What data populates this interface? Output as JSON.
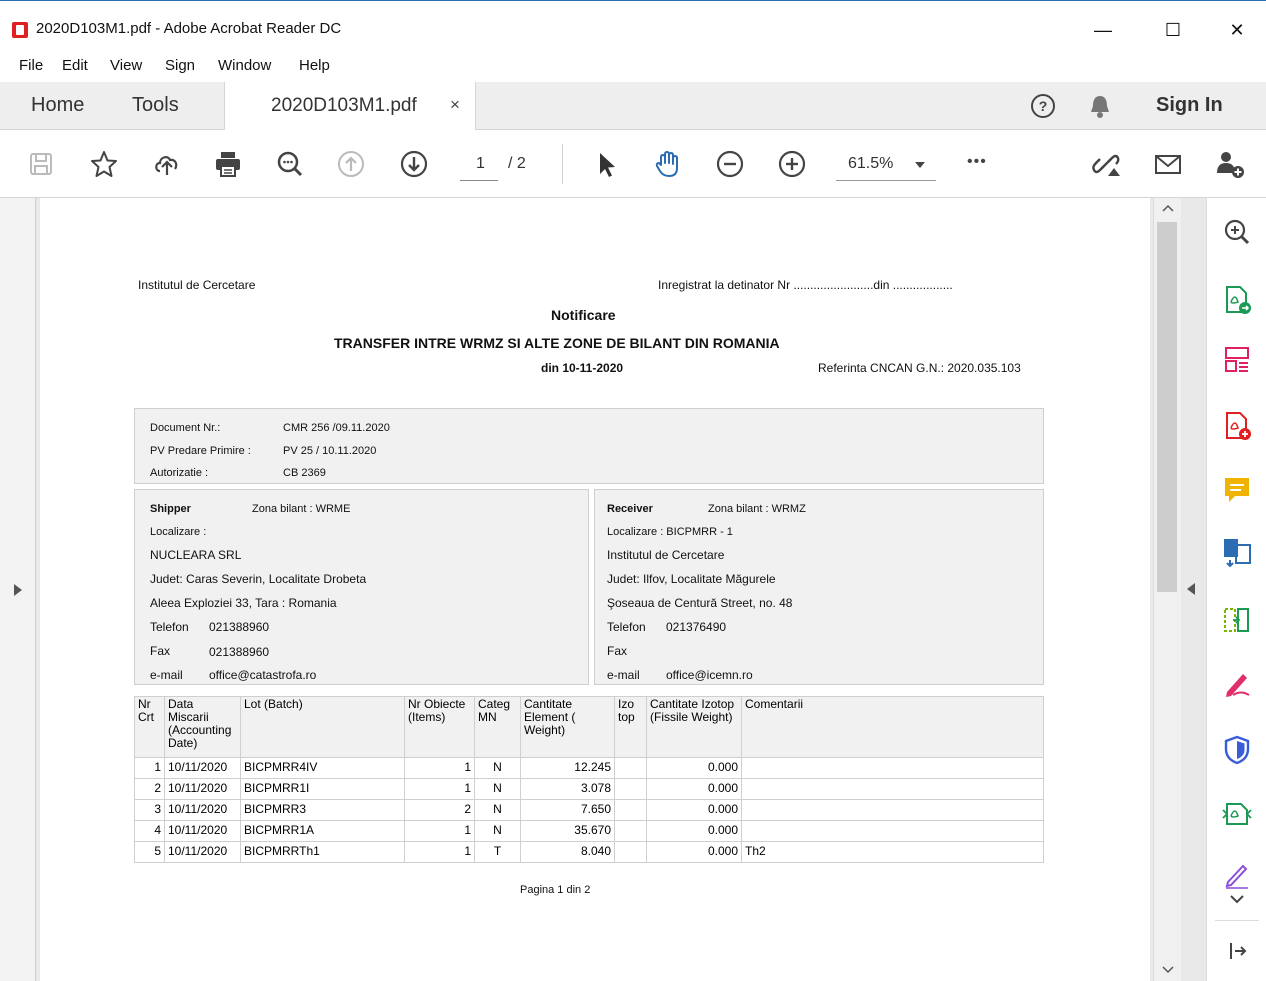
{
  "window": {
    "title": "2020D103M1.pdf - Adobe Acrobat Reader DC",
    "minimize": "—",
    "maximize": "☐",
    "close": "✕"
  },
  "menu": [
    "File",
    "Edit",
    "View",
    "Sign",
    "Window",
    "Help"
  ],
  "tabs": {
    "home": "Home",
    "tools": "Tools",
    "document": "2020D103M1.pdf",
    "close": "×",
    "sign_in": "Sign In"
  },
  "toolbar": {
    "page_current": "1",
    "page_total": "/ 2",
    "zoom": "61.5%",
    "more": "•••"
  },
  "doc": {
    "institute": "Institutul de Cercetare",
    "registered": "Inregistrat la detinator  Nr ........................din ..................",
    "notice": "Notificare",
    "heading": "TRANSFER INTRE WRMZ SI ALTE ZONE DE BILANT DIN ROMANIA",
    "date": "din 10-11-2020",
    "reference": "Referinta CNCAN G.N.: 2020.035.103",
    "info": {
      "doc_label": "Document Nr.:",
      "doc_value": "CMR 256 /09.11.2020",
      "pv_label": "PV Predare Primire :",
      "pv_value": "PV 25 / 10.11.2020",
      "auth_label": "Autorizatie :",
      "auth_value": "CB 2369"
    },
    "shipper": {
      "title": "Shipper",
      "zone": "Zona bilant : WRME",
      "location": "Localizare :",
      "name": "NUCLEARA SRL",
      "county": "Judet: Caras Severin, Localitate Drobeta",
      "address": "Aleea Exploziei 33, Tara : Romania",
      "phone_label": "Telefon",
      "phone": "021388960",
      "fax_label": "Fax",
      "fax": "021388960",
      "email_label": "e-mail",
      "email": "office@catastrofa.ro"
    },
    "receiver": {
      "title": "Receiver",
      "zone": "Zona bilant : WRMZ",
      "location": "Localizare : BICPMRR - 1",
      "name": "Institutul de Cercetare",
      "county": "Judet: Ilfov, Localitate Măgurele",
      "address": "Şoseaua de Centură Street, no. 48",
      "phone_label": "Telefon",
      "phone": "021376490",
      "fax_label": "Fax",
      "fax": "",
      "email_label": "e-mail",
      "email": "office@icemn.ro"
    },
    "table": {
      "headers": [
        "Nr Crt",
        "Data Miscarii (Accounting Date)",
        "Lot (Batch)",
        "Nr Obiecte (Items)",
        "Categ MN",
        "Cantitate Element ( Weight)",
        "Izo top",
        "Cantitate Izotop (Fissile Weight)",
        "Comentarii"
      ],
      "rows": [
        [
          "1",
          "10/11/2020",
          "BICPMRR4IV",
          "1",
          "N",
          "12.245",
          "",
          "0.000",
          ""
        ],
        [
          "2",
          "10/11/2020",
          "BICPMRR1I",
          "1",
          "N",
          "3.078",
          "",
          "0.000",
          ""
        ],
        [
          "3",
          "10/11/2020",
          "BICPMRR3",
          "2",
          "N",
          "7.650",
          "",
          "0.000",
          ""
        ],
        [
          "4",
          "10/11/2020",
          "BICPMRR1A",
          "1",
          "N",
          "35.670",
          "",
          "0.000",
          ""
        ],
        [
          "5",
          "10/11/2020",
          "BICPMRRTh1",
          "1",
          "T",
          "8.040",
          "",
          "0.000",
          "Th2"
        ]
      ]
    },
    "footer": "Pagina 1 din 2"
  },
  "icons": {
    "accent": "#2b6cb3",
    "pdf_red": "#e02020",
    "tool_green": "#1a9a55",
    "tool_purple": "#8a4fd8"
  }
}
